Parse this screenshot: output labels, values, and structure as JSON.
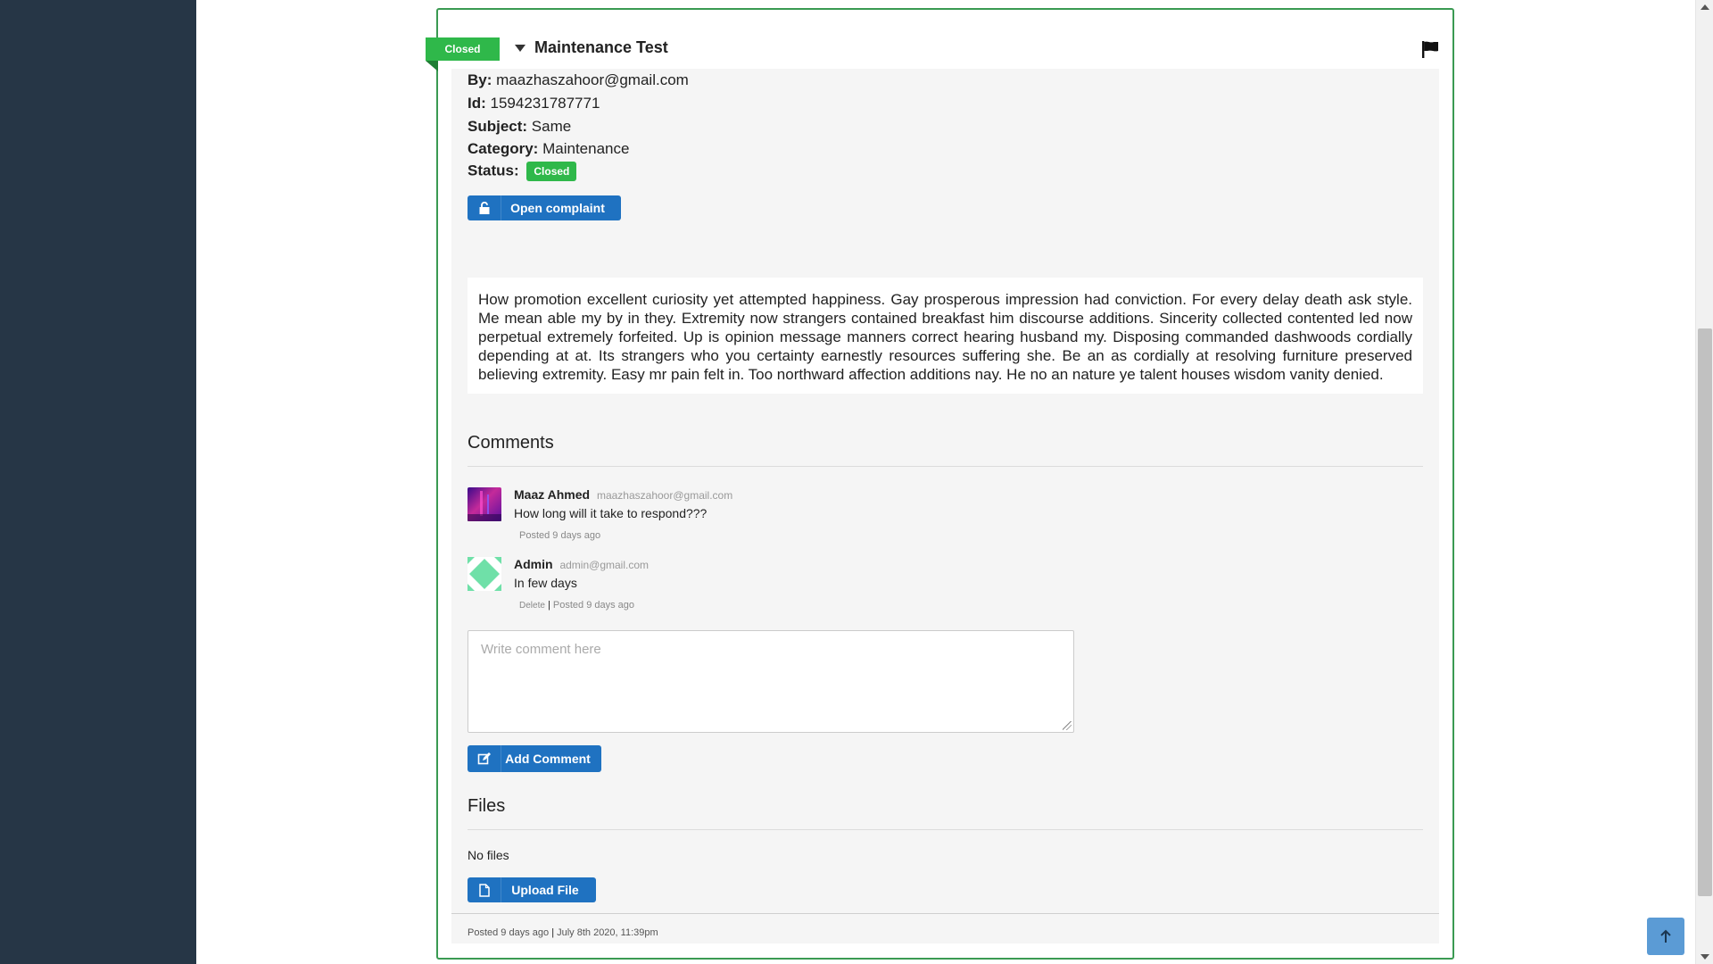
{
  "complaint": {
    "ribbon_label": "Closed",
    "title": "Maintenance Test",
    "by_label": "By:",
    "by_value": "maazhaszahoor@gmail.com",
    "id_label": "Id:",
    "id_value": "1594231787771",
    "subject_label": "Subject:",
    "subject_value": "Same",
    "category_label": "Category:",
    "category_value": "Maintenance",
    "status_label": "Status:",
    "status_value": "Closed",
    "open_button_label": "Open complaint",
    "description": "How promotion excellent curiosity yet attempted happiness. Gay prosperous impression had conviction. For every delay death ask style. Me mean able my by in they. Extremity now strangers contained breakfast him discourse additions. Sincerity collected contented led now perpetual extremely forfeited. Up is opinion message manners correct hearing husband my. Disposing commanded dashwoods cordially depending at at. Its strangers who you certainty earnestly resources suffering she. Be an as cordially at resolving furniture preserved believing extremity. Easy mr pain felt in. Too northward affection additions nay. He no an nature ye talent houses wisdom vanity denied."
  },
  "comments_section": {
    "title": "Comments",
    "items": [
      {
        "name": "Maaz Ahmed",
        "email": "maazhaszahoor@gmail.com",
        "text": "How long will it take to respond???",
        "posted": "Posted 9 days ago"
      },
      {
        "name": "Admin",
        "email": "admin@gmail.com",
        "text": "In few days",
        "delete_label": "Delete",
        "separator": "|",
        "posted": "Posted 9 days ago"
      }
    ],
    "input_placeholder": "Write comment here",
    "add_button_label": "Add Comment"
  },
  "files_section": {
    "title": "Files",
    "empty_text": "No files",
    "upload_button_label": "Upload File"
  },
  "footer": {
    "posted": "Posted 9 days ago",
    "separator": "|",
    "date": "July 8th 2020, 11:39pm"
  },
  "colors": {
    "sidebar": "#263646",
    "success": "#2fb84a",
    "primary": "#1f72c1",
    "card_border": "#3a9a52"
  },
  "icons": {
    "caret": "caret-down-icon",
    "flag": "flag-icon",
    "unlock": "unlock-icon",
    "edit": "edit-icon",
    "file": "file-icon",
    "scroll_top": "arrow-up-icon"
  }
}
